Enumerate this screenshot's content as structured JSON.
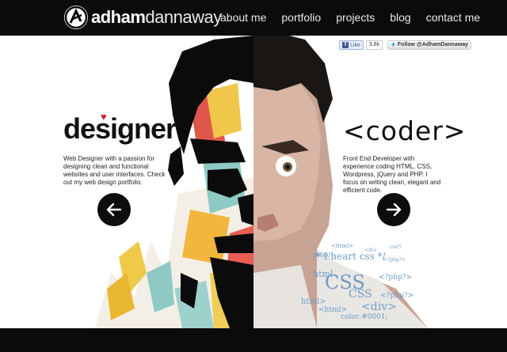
{
  "brand": {
    "bold": "adham",
    "light": "dannaway"
  },
  "nav": [
    {
      "label": "about me"
    },
    {
      "label": "portfolio"
    },
    {
      "label": "projects"
    },
    {
      "label": "blog"
    },
    {
      "label": "contact me"
    }
  ],
  "social": {
    "fb_label": "Like",
    "fb_count": "3.6k",
    "twitter_label": "Follow @AdhamDannaway"
  },
  "designer": {
    "title": "designer",
    "description": "Web Designer with a passion for designing clean and functional websites and user interfaces. Check out my web design portfolio."
  },
  "coder": {
    "title": "<coder>",
    "description": "Front End Developer with experience coding HTML, CSS, Wordpress, jQuery and PHP. I focus on writing clean, elegant and efficient code."
  },
  "code_cloud": [
    "<html>",
    "</b>",
    "css*/",
    "#0001;",
    "<?php?>",
    "html",
    "CSS",
    "/* I heart css */",
    "<?php?>",
    "CSS",
    "html>",
    "<html>",
    "<div>",
    "<?php?>",
    "color:#0001;"
  ],
  "colors": {
    "bar": "#0b0b0b",
    "accent_heart": "#d0202a",
    "code_blue": "#6f9bc4"
  }
}
